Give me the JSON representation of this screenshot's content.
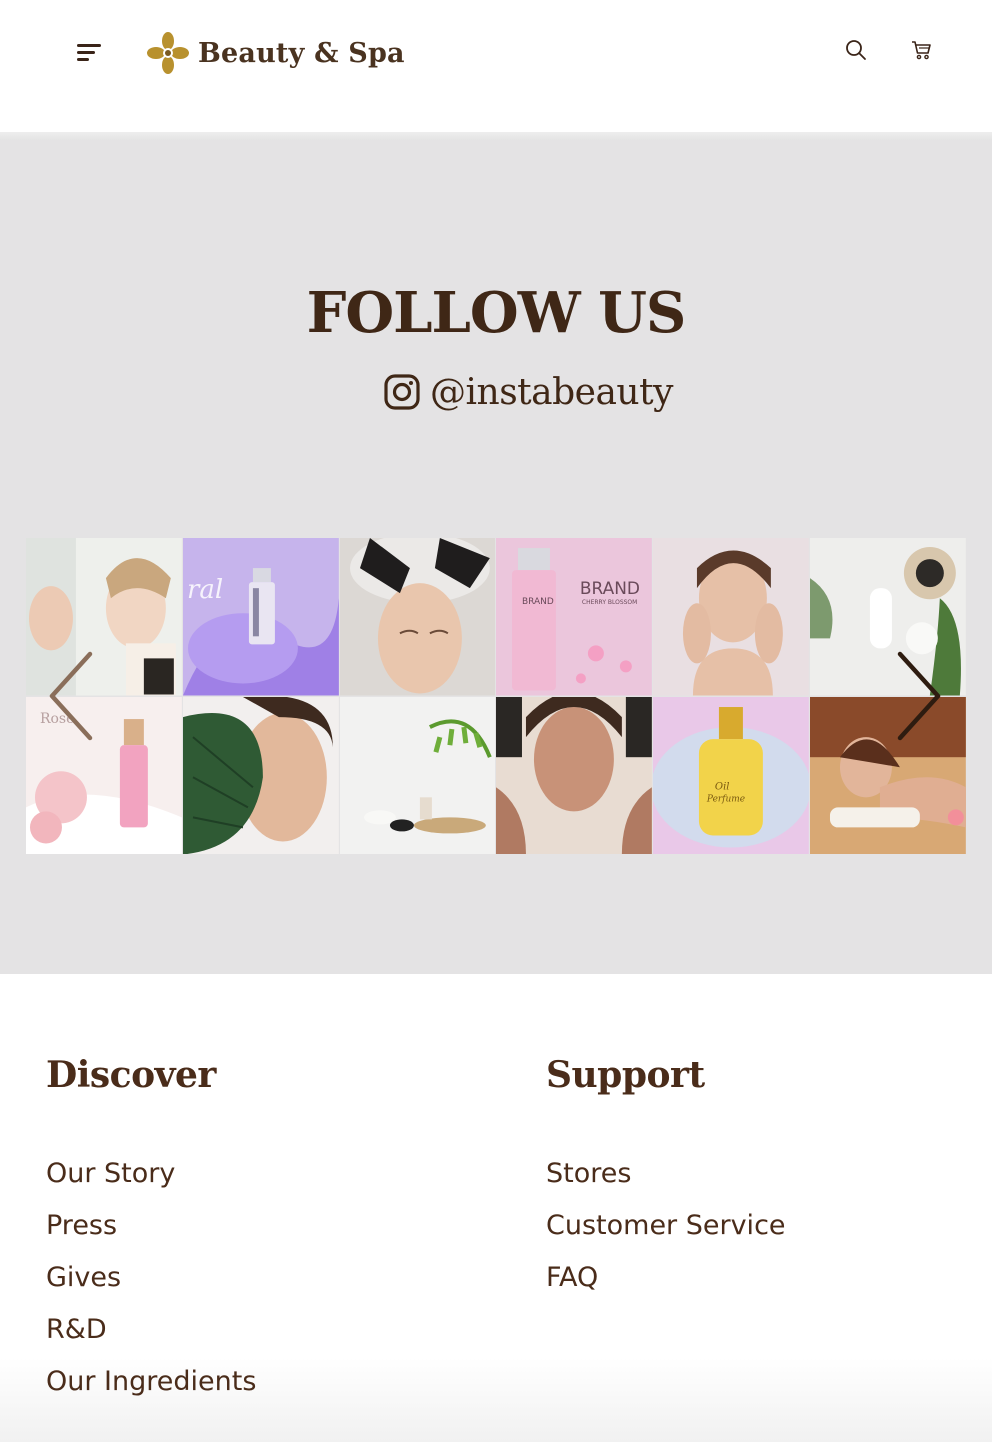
{
  "header": {
    "brand": "Beauty & Spa",
    "brand_color": "#4a3320",
    "accent": "#b8912e",
    "icons": [
      "menu-icon",
      "search-icon",
      "cart-icon"
    ]
  },
  "follow": {
    "title": "FOLLOW US",
    "handle": "@instabeauty",
    "background": "#e4e3e4",
    "gallery": [
      {
        "name": "gallery-photo-face-mirror"
      },
      {
        "name": "gallery-photo-purple-serum"
      },
      {
        "name": "gallery-photo-brow-treatment"
      },
      {
        "name": "gallery-photo-brand-cherry-blossom",
        "text": [
          "BRAND",
          "CHERRY BLOSSOM"
        ]
      },
      {
        "name": "gallery-photo-woman-portrait"
      },
      {
        "name": "gallery-photo-spa-products"
      },
      {
        "name": "gallery-photo-rose-bottle",
        "text": [
          "Rose"
        ]
      },
      {
        "name": "gallery-photo-leaf-face"
      },
      {
        "name": "gallery-photo-spa-stones"
      },
      {
        "name": "gallery-photo-face-massage"
      },
      {
        "name": "gallery-photo-oil-perfume",
        "text": [
          "Oil Perfume"
        ]
      },
      {
        "name": "gallery-photo-back-massage"
      }
    ]
  },
  "footer": {
    "discover": {
      "title": "Discover",
      "links": [
        "Our Story",
        "Press",
        "Gives",
        "R&D",
        "Our Ingredients"
      ]
    },
    "support": {
      "title": "Support",
      "links": [
        "Stores",
        "Customer Service",
        "FAQ"
      ]
    }
  }
}
